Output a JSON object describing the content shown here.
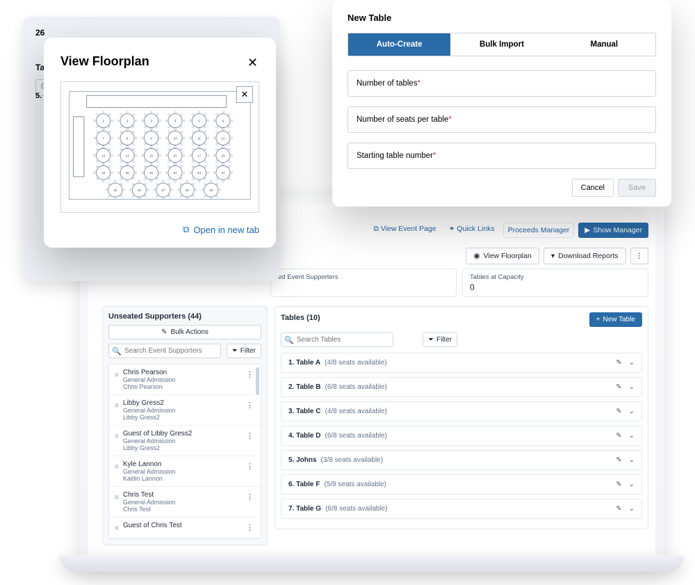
{
  "floorplan_modal": {
    "title": "View Floorplan",
    "open_in_new_tab": "Open in new tab"
  },
  "shadow_panel": {
    "partial_num": "26",
    "header": "Tab",
    "filter_stub": "r"
  },
  "new_table_modal": {
    "title": "New Table",
    "tabs": {
      "auto": "Auto-Create",
      "bulk": "Bulk Import",
      "manual": "Manual"
    },
    "fields": {
      "num_tables": "Number of tables",
      "seats_per_table": "Number of seats per table",
      "starting_num": "Starting table number"
    },
    "cancel": "Cancel",
    "save": "Save"
  },
  "app": {
    "top_links": {
      "view_event_page": "View Event Page",
      "quick_links": "Quick Links",
      "proceeds_manager": "Proceeds Manager",
      "show_manager": "Show Manager"
    },
    "mid_buttons": {
      "view_floorplan": "View Floorplan",
      "download_reports": "Download Reports"
    },
    "stats": {
      "card1_label": "ed Event Supporters",
      "card2_label": "Tables at Capacity",
      "card2_value": "0"
    },
    "unseated": {
      "title": "Unseated Supporters (44)",
      "bulk_actions": "Bulk Actions",
      "search_placeholder": "Search Event Supporters",
      "filter": "Filter",
      "items": [
        {
          "name": "Chris Pearson",
          "tier": "General Admission",
          "host": "Chris Pearson"
        },
        {
          "name": "Libby Gress2",
          "tier": "General Admission",
          "host": "Libby Gress2"
        },
        {
          "name": "Guest of Libby Gress2",
          "tier": "General Admission",
          "host": "Libby Gress2"
        },
        {
          "name": "Kyle Lannon",
          "tier": "General Admission",
          "host": "Kaitlin Lannon"
        },
        {
          "name": "Chris Test",
          "tier": "General Admission",
          "host": "Chris Test"
        },
        {
          "name": "Guest of Chris Test",
          "tier": "",
          "host": ""
        }
      ]
    },
    "tables": {
      "title": "Tables (10)",
      "new_table": "New Table",
      "search_placeholder": "Search Tables",
      "filter": "Filter",
      "rows": [
        {
          "idx": "1.",
          "name": "Table A",
          "seats": "(4/8 seats available)"
        },
        {
          "idx": "2.",
          "name": "Table B",
          "seats": "(6/8 seats available)"
        },
        {
          "idx": "3.",
          "name": "Table C",
          "seats": "(4/8 seats available)"
        },
        {
          "idx": "4.",
          "name": "Table D",
          "seats": "(6/8 seats available)"
        },
        {
          "idx": "5.",
          "name": "Johns",
          "seats": "(3/8 seats available)"
        },
        {
          "idx": "6.",
          "name": "Table F",
          "seats": "(5/8 seats available)"
        },
        {
          "idx": "7.",
          "name": "Table G",
          "seats": "(6/8 seats available)"
        }
      ]
    },
    "peek_row": {
      "idx": "5.",
      "name": "Johns",
      "seats": "(3/8 seats available)"
    }
  }
}
